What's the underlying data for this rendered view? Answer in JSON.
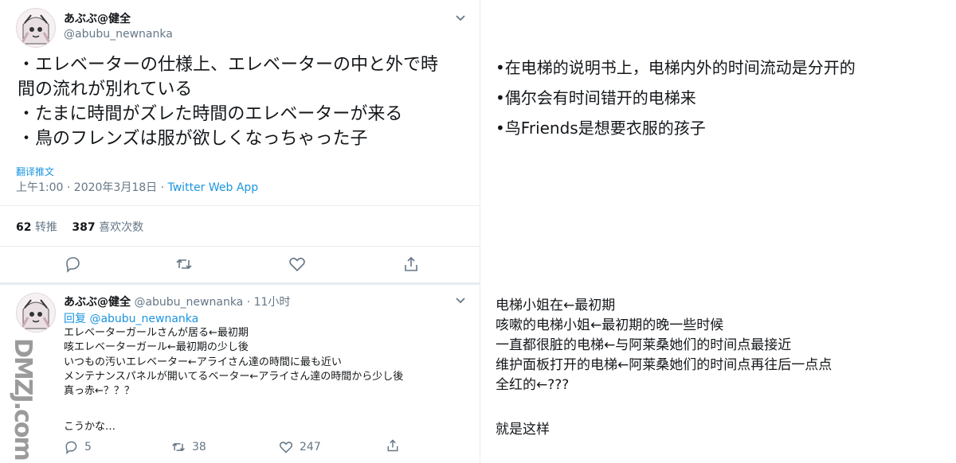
{
  "tweet": {
    "name": "あぶぶ@健全",
    "handle": "@abubu_newnanka",
    "lines": [
      "・エレベーターの仕様上、エレベーターの中と外で時",
      "間の流れが別れている",
      "・たまに時間がズレた時間のエレベーターが来る",
      "・鳥のフレンズは服が欲しくなっちゃった子"
    ],
    "translate": "翻译推文",
    "time": "上午1:00 · 2020年3月18日 · ",
    "app": "Twitter Web App",
    "retweets_count": "62",
    "retweets_label": "转推",
    "likes_count": "387",
    "likes_label": "喜欢次数"
  },
  "reply": {
    "name": "あぶぶ@健全",
    "handle_time": "@abubu_newnanka · 11小时",
    "replying_to": "回复 @abubu_newnanka",
    "lines": [
      "エレベーターガールさんが居る←最初期",
      "咳エレベーターガール←最初期の少し後",
      "いつもの汚いエレベーター←アライさん達の時間に最も近い",
      "メンテナンスパネルが開いてるベーター←アライさん達の時間から少し後",
      "真っ赤←？？？"
    ],
    "ending": "こうかな…",
    "reply_count": "5",
    "retweet_count": "38",
    "like_count": "247"
  },
  "translation": {
    "bullets": [
      "•在电梯的说明书上，电梯内外的时间流动是分开的",
      "•偶尔会有时间错开的电梯来",
      "•鸟Friends是想要衣服的孩子"
    ],
    "notes": [
      "电梯小姐在←最初期",
      "咳嗽的电梯小姐←最初期的晚一些时候",
      "一直都很脏的电梯←与阿莱桑她们的时间点最接近",
      "维护面板打开的电梯←阿莱桑她们的时间点再往后一点点",
      "全红的←???"
    ],
    "ending": "就是这样"
  },
  "watermark": "DMZJ.com",
  "colors": {
    "link": "#1b95e0",
    "muted": "#657786",
    "divider": "#e6ecf0"
  },
  "icons": [
    "chevron-down-icon",
    "reply-icon",
    "retweet-icon",
    "like-icon",
    "share-icon"
  ]
}
